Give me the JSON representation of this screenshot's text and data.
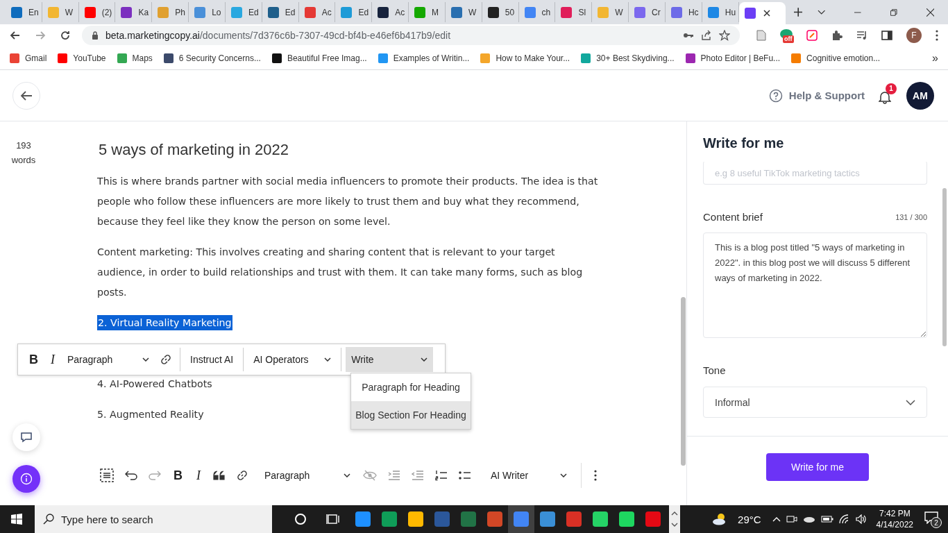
{
  "browser": {
    "tabs": [
      {
        "label": "En",
        "color": "#0f6cbd",
        "selected": false
      },
      {
        "label": "W",
        "color": "#f2b632",
        "selected": false
      },
      {
        "label": "(2)",
        "color": "#ff0000",
        "selected": false
      },
      {
        "label": "Ka",
        "color": "#7b2fbf",
        "selected": false
      },
      {
        "label": "Ph",
        "color": "#e0a030",
        "selected": false
      },
      {
        "label": "Lo",
        "color": "#4a90d9",
        "selected": false
      },
      {
        "label": "Ed",
        "color": "#29a8e0",
        "selected": false
      },
      {
        "label": "Ed",
        "color": "#1f5f8b",
        "selected": false
      },
      {
        "label": "Ac",
        "color": "#e53935",
        "selected": false
      },
      {
        "label": "Ed",
        "color": "#1e9bd7",
        "selected": false
      },
      {
        "label": "Ac",
        "color": "#17233d",
        "selected": false
      },
      {
        "label": "M",
        "color": "#14a800",
        "selected": false
      },
      {
        "label": "W",
        "color": "#2a6fb0",
        "selected": false
      },
      {
        "label": "50",
        "color": "#222222",
        "selected": false
      },
      {
        "label": "ch",
        "color": "#4285f4",
        "selected": false
      },
      {
        "label": "Sl",
        "color": "#e01e5a",
        "selected": false
      },
      {
        "label": "W",
        "color": "#f2b632",
        "selected": false
      },
      {
        "label": "Cr",
        "color": "#7b68ee",
        "selected": false
      },
      {
        "label": "Hc",
        "color": "#6d6be8",
        "selected": false
      },
      {
        "label": "Hu",
        "color": "#1e88e5",
        "selected": false
      },
      {
        "color": "#6c3ef5",
        "selected": true
      }
    ],
    "url_host": "beta.marketingcopy.ai",
    "url_path": "/documents/7d376c6b-7307-49cd-bf4b-e46ef6b417b9/edit",
    "extension_badge": "off",
    "profile_initial": "F",
    "bookmarks": [
      {
        "label": "Gmail",
        "color": "#ea4335"
      },
      {
        "label": "YouTube",
        "color": "#ff0000"
      },
      {
        "label": "Maps",
        "color": "#34a853"
      },
      {
        "label": "6 Security Concerns...",
        "color": "#3c4a6b"
      },
      {
        "label": "Beautiful Free Imag...",
        "color": "#111111"
      },
      {
        "label": "Examples of Writin...",
        "color": "#2196f3"
      },
      {
        "label": "How to Make Your...",
        "color": "#f4a62a"
      },
      {
        "label": "30+ Best Skydiving...",
        "color": "#12a89d"
      },
      {
        "label": "Photo Editor | BeFu...",
        "color": "#9c27b0"
      },
      {
        "label": "Cognitive emotion...",
        "color": "#f57c00"
      }
    ],
    "bookmarks_more": "»"
  },
  "header": {
    "help": "Help & Support",
    "notifications": "1",
    "avatar": "AM"
  },
  "editor": {
    "word_count": "193",
    "word_label": "words",
    "title": "5 ways of marketing in 2022",
    "blocks": [
      {
        "text": "This is where brands partner with social media influencers to promote their products. The idea is that people who follow these influencers are more likely to trust them and buy what they recommend, because they feel like they know the person on some level.",
        "selected": false
      },
      {
        "text": "Content marketing: This involves creating and sharing content that is relevant to your target audience, in order to build relationships and trust with them. It can take many forms, such as blog posts.",
        "selected": false
      },
      {
        "text": "2. Virtual Reality Marketing",
        "selected": true
      },
      {
        "text": "4. AI-Powered Chatbots",
        "selected": false
      },
      {
        "text": "5. Augmented Reality",
        "selected": false
      }
    ],
    "float_toolbar": {
      "bold": "B",
      "italic": "I",
      "format": "Paragraph",
      "instruct": "Instruct AI",
      "operators": "AI Operators",
      "write": "Write",
      "write_open": true,
      "menu": [
        {
          "label": "Paragraph for Heading",
          "selected": false
        },
        {
          "label": "Blog Section For Heading",
          "selected": true
        }
      ]
    },
    "bottom_toolbar": {
      "bold": "B",
      "italic": "I",
      "format": "Paragraph",
      "ai": "AI Writer"
    }
  },
  "panel": {
    "title": "Write for me",
    "topic_placeholder": "e.g 8 useful TikTok marketing tactics",
    "brief_label": "Content brief",
    "brief_count": "131 / 300",
    "brief": "This is a blog post titled \"5 ways of marketing in 2022\". in this blog post we will discuss 5 different ways of marketing in 2022.",
    "tone_label": "Tone",
    "tone": "Informal",
    "button": "Write for me"
  },
  "taskbar": {
    "search_placeholder": "Type here to search",
    "apps": [
      {
        "color": "#1e90ff",
        "selected": false
      },
      {
        "color": "#0f9d58",
        "selected": false
      },
      {
        "color": "#ffb900",
        "selected": false
      },
      {
        "color": "#2b579a",
        "selected": false
      },
      {
        "color": "#217346",
        "selected": false
      },
      {
        "color": "#d24726",
        "selected": false
      },
      {
        "color": "#4285f4",
        "selected": true
      },
      {
        "color": "#3a8fd6",
        "selected": false
      },
      {
        "color": "#d93025",
        "selected": false
      },
      {
        "color": "#25d366",
        "selected": false
      },
      {
        "color": "#1ed760",
        "selected": false
      },
      {
        "color": "#e50914",
        "selected": false
      }
    ],
    "temperature": "29°C",
    "time": "7:42 PM",
    "date": "4/14/2022",
    "notifications": "2"
  }
}
